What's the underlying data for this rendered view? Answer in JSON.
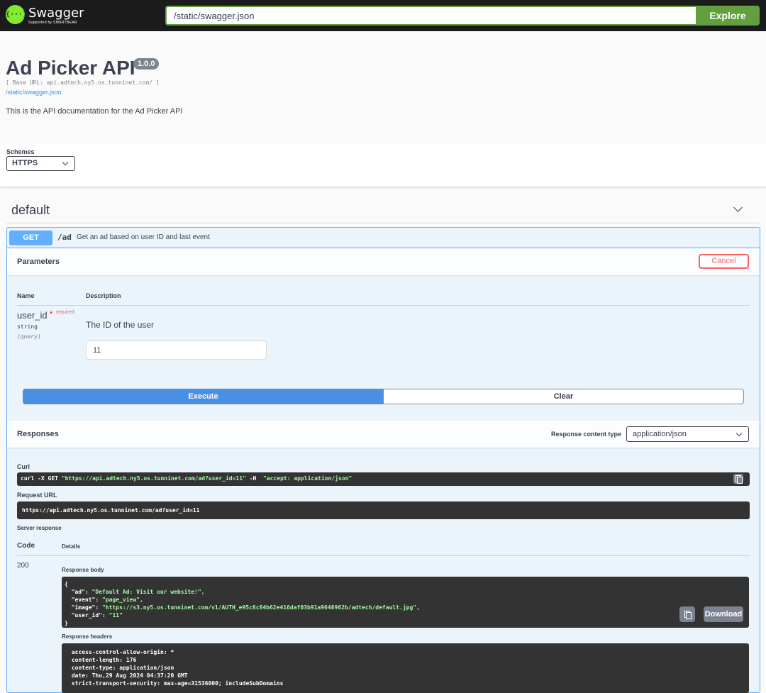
{
  "topbar": {
    "logo_text": "Swagger",
    "logo_sub": "Supported by SMARTBEAR",
    "logo_glyph": "{···}",
    "url_value": "/static/swagger.json",
    "explore_label": "Explore"
  },
  "info": {
    "title": "Ad Picker API",
    "version": "1.0.0",
    "base_url": "[ Base URL: api.adtech.ny5.os.tunninet.com/ ]",
    "spec_link": "/static/swagger.json",
    "description": "This is the API documentation for the Ad Picker API"
  },
  "schemes": {
    "label": "Schemes",
    "selected": "HTTPS"
  },
  "tag": {
    "name": "default"
  },
  "operation": {
    "method": "GET",
    "path": "/ad",
    "summary": "Get an ad based on user ID and last event",
    "parameters_title": "Parameters",
    "cancel_label": "Cancel",
    "col_name": "Name",
    "col_description": "Description",
    "param": {
      "name": "user_id",
      "required_star": "*",
      "required_label": "required",
      "type": "string",
      "in": "(query)",
      "description": "The ID of the user",
      "value": "11"
    },
    "execute_label": "Execute",
    "clear_label": "Clear"
  },
  "responses": {
    "title": "Responses",
    "content_type_label": "Response content type",
    "content_type_value": "application/json",
    "curl_label": "Curl",
    "curl_cmd": "curl -X GET ",
    "curl_url": "\"https://api.adtech.ny5.os.tunninet.com/ad?user_id=11\"",
    "curl_h": " -H  ",
    "curl_header": "\"accept: application/json\"",
    "request_url_label": "Request URL",
    "request_url": "https://api.adtech.ny5.os.tunninet.com/ad?user_id=11",
    "server_response_label": "Server response",
    "col_code": "Code",
    "col_details": "Details",
    "status_code": "200",
    "body_label": "Response body",
    "body_lines": [
      "{",
      "  \"ad\": ",
      "  \"event\": ",
      "  \"image\": ",
      "  \"user_id\": ",
      "}"
    ],
    "body_values": [
      "",
      "\"Default Ad: Visit our website!\",",
      "\"page_view\",",
      "\"https://s3.ny5.os.tunninet.com/v1/AUTH_e95c8c84b62e416daf03b91a9648962b/adtech/default.jpg\",",
      "\"11\"",
      ""
    ],
    "download_label": "Download",
    "headers_label": "Response headers",
    "headers": [
      " access-control-allow-origin: * ",
      " content-length: 176 ",
      " content-type: application/json ",
      " date: Thu,29 Aug 2024 04:37:20 GMT ",
      " strict-transport-security: max-age=31536000; includeSubDomains "
    ]
  },
  "colors": {
    "topbar_bg": "#1b1b1b",
    "explore_green": "#62a03f",
    "get_blue": "#61affe",
    "execute_blue": "#4990e2",
    "cancel_red": "#ff6060"
  }
}
